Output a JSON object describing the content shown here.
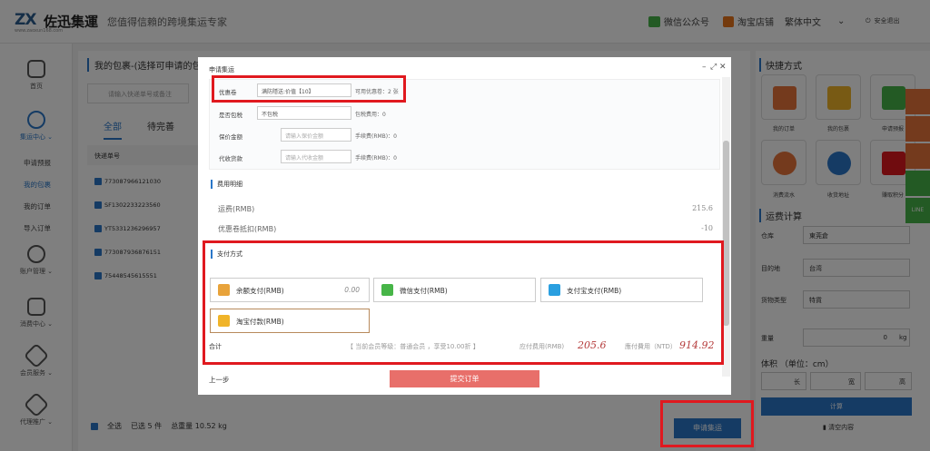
{
  "header": {
    "logo": "ZX",
    "logo_cn": "佐迅集運",
    "logo_sub": "www.zaoxun168.com",
    "slogan": "您值得信賴的跨境集运专家",
    "wechat": "微信公众号",
    "taobao": "淘宝店铺",
    "lang": "繁体中文",
    "logout": "安全退出"
  },
  "sidebar": {
    "home": "首页",
    "center": "集运中心",
    "sub": [
      "申请预报",
      "我的包裹",
      "我的订单",
      "导入订单"
    ],
    "account": "账户管理",
    "consume": "消费中心",
    "member": "会员服务",
    "agent": "代理推广"
  },
  "main": {
    "title": "我的包裹-(选择可申请的包",
    "search_placeholder": "请输入快递单号或备注",
    "tabs": [
      "全部",
      "待完善"
    ],
    "col": "快递单号",
    "rows": [
      "773087966121030",
      "SF1302233223560",
      "YT5331236296957",
      "773087936876151",
      "75448545615551"
    ],
    "select_all": "全选",
    "selected": "已选 5 件",
    "weight": "总重量 10.52 kg",
    "apply": "申请集运"
  },
  "right": {
    "quick_title": "快捷方式",
    "quick": [
      "我的订单",
      "我的包裹",
      "申请预报",
      "消费流水",
      "收货地址",
      "赚取积分"
    ],
    "calc_title": "运费计算",
    "warehouse_label": "仓库",
    "warehouse": "東莞倉",
    "dest_label": "目的地",
    "dest": "台湾",
    "goods_label": "货物类型",
    "goods": "特貨",
    "weight_label": "重量",
    "weight_unit": "kg",
    "weight_value": "0",
    "volume_label": "体积 （单位：cm）",
    "len": "长",
    "wid": "宽",
    "hei": "高",
    "calc_btn": "计算",
    "clear": "清空内容"
  },
  "modal": {
    "title": "申请集运",
    "coupon_label": "优惠卷",
    "coupon_value": "满防隱送:价值【10】",
    "coupon_note": "可用优惠卷：2 张",
    "tax_label": "是否包税",
    "tax_value": "不包税",
    "tax_note": "包税费用：0",
    "insure_label": "保价金额",
    "insure_ph": "请输入保价金额",
    "insure_note": "手续费(RMB)：0",
    "collect_label": "代收货款",
    "collect_ph": "请输入代收金额",
    "collect_note": "手续费(RMB)：0",
    "fee_title": "费用明细",
    "freight_label": "运费(RMB)",
    "freight": "215.6",
    "discount_label": "优惠卷抵扣(RMB)",
    "discount": "-10",
    "pay_title": "支付方式",
    "pay_balance": "余额支付(RMB)",
    "pay_balance_amt": "0.00",
    "pay_wechat": "微信支付(RMB)",
    "pay_alipay": "支付宝支付(RMB)",
    "pay_taobao": "淘宝付款(RMB)",
    "total_label": "合计",
    "member_info": "【 当前会员等级：普通会员 ，享受10.00折 】",
    "payable_label": "应付费用(RMB)",
    "payable": "205.6",
    "ntd_label": "應付費用（NTD）",
    "ntd": "914.92",
    "back": "上一步",
    "submit": "提交订单"
  },
  "colors": {
    "accent": "#2a77c9",
    "highlight": "#e0191f",
    "submit": "#e86f6a"
  }
}
